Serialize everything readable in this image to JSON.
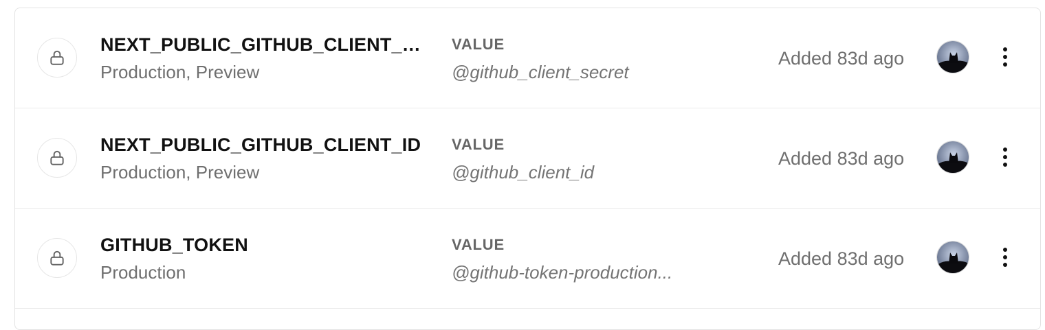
{
  "env_vars": [
    {
      "name": "NEXT_PUBLIC_GITHUB_CLIENT_S...",
      "targets": "Production, Preview",
      "value_label": "VALUE",
      "value": "@github_client_secret",
      "added": "Added 83d ago",
      "icon": "lock-icon"
    },
    {
      "name": "NEXT_PUBLIC_GITHUB_CLIENT_ID",
      "targets": "Production, Preview",
      "value_label": "VALUE",
      "value": "@github_client_id",
      "added": "Added 83d ago",
      "icon": "lock-icon"
    },
    {
      "name": "GITHUB_TOKEN",
      "targets": "Production",
      "value_label": "VALUE",
      "value": "@github-token-production...",
      "added": "Added 83d ago",
      "icon": "lock-icon"
    }
  ],
  "colors": {
    "border": "#e3e3e3",
    "name": "#111111",
    "muted": "#6f6f6f"
  }
}
